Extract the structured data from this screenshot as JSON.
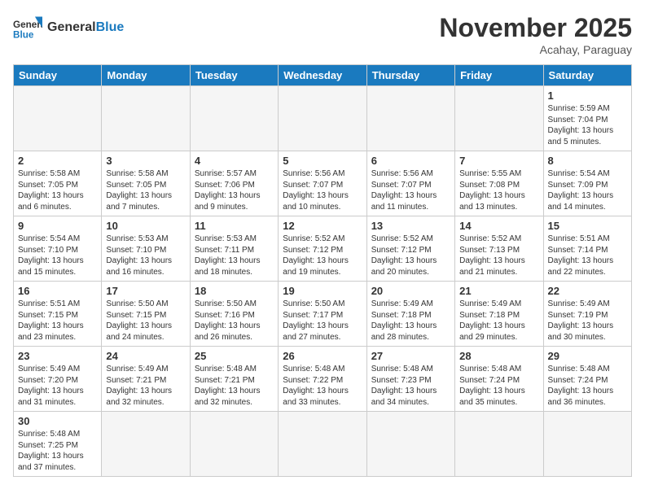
{
  "header": {
    "logo_general": "General",
    "logo_blue": "Blue",
    "month_title": "November 2025",
    "location": "Acahay, Paraguay"
  },
  "days_of_week": [
    "Sunday",
    "Monday",
    "Tuesday",
    "Wednesday",
    "Thursday",
    "Friday",
    "Saturday"
  ],
  "weeks": [
    {
      "days": [
        {
          "num": "",
          "info": ""
        },
        {
          "num": "",
          "info": ""
        },
        {
          "num": "",
          "info": ""
        },
        {
          "num": "",
          "info": ""
        },
        {
          "num": "",
          "info": ""
        },
        {
          "num": "",
          "info": ""
        },
        {
          "num": "1",
          "info": "Sunrise: 5:59 AM\nSunset: 7:04 PM\nDaylight: 13 hours\nand 5 minutes."
        }
      ]
    },
    {
      "days": [
        {
          "num": "2",
          "info": "Sunrise: 5:58 AM\nSunset: 7:05 PM\nDaylight: 13 hours\nand 6 minutes."
        },
        {
          "num": "3",
          "info": "Sunrise: 5:58 AM\nSunset: 7:05 PM\nDaylight: 13 hours\nand 7 minutes."
        },
        {
          "num": "4",
          "info": "Sunrise: 5:57 AM\nSunset: 7:06 PM\nDaylight: 13 hours\nand 9 minutes."
        },
        {
          "num": "5",
          "info": "Sunrise: 5:56 AM\nSunset: 7:07 PM\nDaylight: 13 hours\nand 10 minutes."
        },
        {
          "num": "6",
          "info": "Sunrise: 5:56 AM\nSunset: 7:07 PM\nDaylight: 13 hours\nand 11 minutes."
        },
        {
          "num": "7",
          "info": "Sunrise: 5:55 AM\nSunset: 7:08 PM\nDaylight: 13 hours\nand 13 minutes."
        },
        {
          "num": "8",
          "info": "Sunrise: 5:54 AM\nSunset: 7:09 PM\nDaylight: 13 hours\nand 14 minutes."
        }
      ]
    },
    {
      "days": [
        {
          "num": "9",
          "info": "Sunrise: 5:54 AM\nSunset: 7:10 PM\nDaylight: 13 hours\nand 15 minutes."
        },
        {
          "num": "10",
          "info": "Sunrise: 5:53 AM\nSunset: 7:10 PM\nDaylight: 13 hours\nand 16 minutes."
        },
        {
          "num": "11",
          "info": "Sunrise: 5:53 AM\nSunset: 7:11 PM\nDaylight: 13 hours\nand 18 minutes."
        },
        {
          "num": "12",
          "info": "Sunrise: 5:52 AM\nSunset: 7:12 PM\nDaylight: 13 hours\nand 19 minutes."
        },
        {
          "num": "13",
          "info": "Sunrise: 5:52 AM\nSunset: 7:12 PM\nDaylight: 13 hours\nand 20 minutes."
        },
        {
          "num": "14",
          "info": "Sunrise: 5:52 AM\nSunset: 7:13 PM\nDaylight: 13 hours\nand 21 minutes."
        },
        {
          "num": "15",
          "info": "Sunrise: 5:51 AM\nSunset: 7:14 PM\nDaylight: 13 hours\nand 22 minutes."
        }
      ]
    },
    {
      "days": [
        {
          "num": "16",
          "info": "Sunrise: 5:51 AM\nSunset: 7:15 PM\nDaylight: 13 hours\nand 23 minutes."
        },
        {
          "num": "17",
          "info": "Sunrise: 5:50 AM\nSunset: 7:15 PM\nDaylight: 13 hours\nand 24 minutes."
        },
        {
          "num": "18",
          "info": "Sunrise: 5:50 AM\nSunset: 7:16 PM\nDaylight: 13 hours\nand 26 minutes."
        },
        {
          "num": "19",
          "info": "Sunrise: 5:50 AM\nSunset: 7:17 PM\nDaylight: 13 hours\nand 27 minutes."
        },
        {
          "num": "20",
          "info": "Sunrise: 5:49 AM\nSunset: 7:18 PM\nDaylight: 13 hours\nand 28 minutes."
        },
        {
          "num": "21",
          "info": "Sunrise: 5:49 AM\nSunset: 7:18 PM\nDaylight: 13 hours\nand 29 minutes."
        },
        {
          "num": "22",
          "info": "Sunrise: 5:49 AM\nSunset: 7:19 PM\nDaylight: 13 hours\nand 30 minutes."
        }
      ]
    },
    {
      "days": [
        {
          "num": "23",
          "info": "Sunrise: 5:49 AM\nSunset: 7:20 PM\nDaylight: 13 hours\nand 31 minutes."
        },
        {
          "num": "24",
          "info": "Sunrise: 5:49 AM\nSunset: 7:21 PM\nDaylight: 13 hours\nand 32 minutes."
        },
        {
          "num": "25",
          "info": "Sunrise: 5:48 AM\nSunset: 7:21 PM\nDaylight: 13 hours\nand 32 minutes."
        },
        {
          "num": "26",
          "info": "Sunrise: 5:48 AM\nSunset: 7:22 PM\nDaylight: 13 hours\nand 33 minutes."
        },
        {
          "num": "27",
          "info": "Sunrise: 5:48 AM\nSunset: 7:23 PM\nDaylight: 13 hours\nand 34 minutes."
        },
        {
          "num": "28",
          "info": "Sunrise: 5:48 AM\nSunset: 7:24 PM\nDaylight: 13 hours\nand 35 minutes."
        },
        {
          "num": "29",
          "info": "Sunrise: 5:48 AM\nSunset: 7:24 PM\nDaylight: 13 hours\nand 36 minutes."
        }
      ]
    },
    {
      "days": [
        {
          "num": "30",
          "info": "Sunrise: 5:48 AM\nSunset: 7:25 PM\nDaylight: 13 hours\nand 37 minutes."
        },
        {
          "num": "",
          "info": ""
        },
        {
          "num": "",
          "info": ""
        },
        {
          "num": "",
          "info": ""
        },
        {
          "num": "",
          "info": ""
        },
        {
          "num": "",
          "info": ""
        },
        {
          "num": "",
          "info": ""
        }
      ]
    }
  ]
}
